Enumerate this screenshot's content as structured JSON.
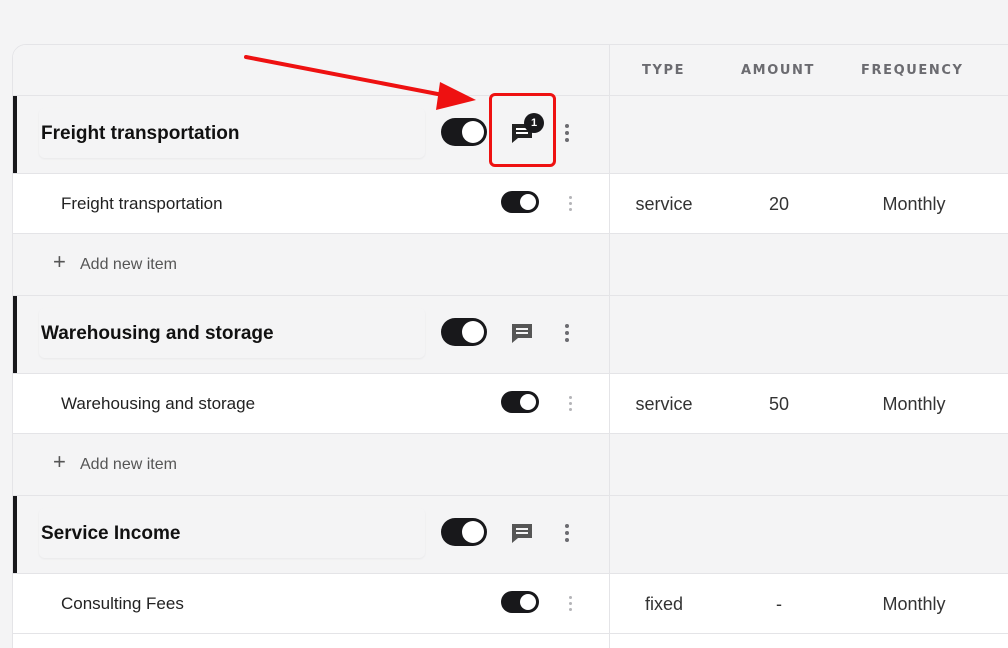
{
  "header": {
    "columns": [
      "TYPE",
      "AMOUNT",
      "FREQUENCY"
    ]
  },
  "groups": [
    {
      "name": "Freight transportation",
      "comment_badge": "1",
      "items": [
        {
          "name": "Freight transportation",
          "type": "service",
          "amount": "20",
          "frequency": "Monthly"
        }
      ],
      "add_label": "Add new item"
    },
    {
      "name": "Warehousing and storage",
      "items": [
        {
          "name": "Warehousing and storage",
          "type": "service",
          "amount": "50",
          "frequency": "Monthly"
        }
      ],
      "add_label": "Add new item"
    },
    {
      "name": "Service Income",
      "items": [
        {
          "name": "Consulting Fees",
          "type": "fixed",
          "amount": "-",
          "frequency": "Monthly"
        }
      ]
    }
  ],
  "colors": {
    "accent": "#18181b",
    "annotation": "#ee1111",
    "group_bg": "#f4f4f5"
  },
  "icons": [
    "comment-icon",
    "kebab-menu-icon",
    "toggle-switch",
    "plus-icon",
    "annotation-arrow"
  ]
}
